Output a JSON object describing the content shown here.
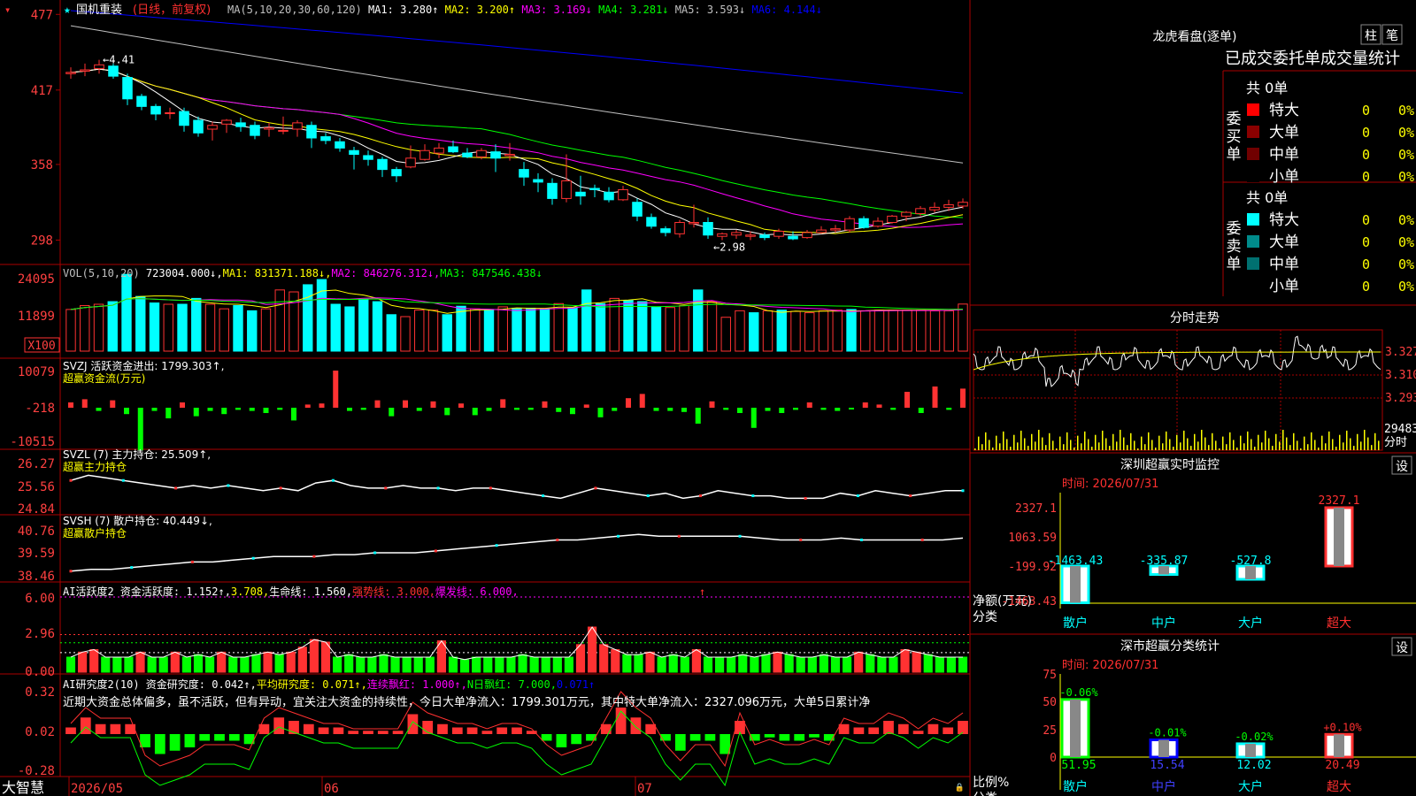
{
  "colors": {
    "up": "#ff3232",
    "down": "#00ffff",
    "frame": "#aa0000",
    "axis_text": "#ff4040",
    "ma1": "#ffffff",
    "ma2": "#ffff00",
    "ma3": "#ff00ff",
    "ma4": "#00ff00",
    "ma5": "#c0c0c0",
    "ma6": "#0000ff"
  },
  "price": {
    "header": {
      "name": "国机重装",
      "period": "(日线，前复权)",
      "ma_params": "MA(5,10,20,30,60,120)",
      "items": [
        {
          "label": "MA1:",
          "value": "3.280",
          "arrow": "↑",
          "color": "#ffffff"
        },
        {
          "label": "MA2:",
          "value": "3.200",
          "arrow": "↑",
          "color": "#ffff00"
        },
        {
          "label": "MA3:",
          "value": "3.169",
          "arrow": "↓",
          "color": "#ff00ff"
        },
        {
          "label": "MA4:",
          "value": "3.281",
          "arrow": "↓",
          "color": "#00ff00"
        },
        {
          "label": "MA5:",
          "value": "3.593",
          "arrow": "↓",
          "color": "#c0c0c0"
        },
        {
          "label": "MA6:",
          "value": "4.144",
          "arrow": "↓",
          "color": "#0000ff"
        }
      ]
    },
    "yticks": [
      "477",
      "417",
      "358",
      "298"
    ],
    "high_label": "←4.41",
    "low_label": "←2.98"
  },
  "volume": {
    "header": [
      {
        "text": "VOL(5,10,20)",
        "color": "#c0c0c0"
      },
      {
        "text": " 723004.000↓,",
        "color": "#ffffff"
      },
      {
        "text": "MA1: 831371.188↓,",
        "color": "#ffff00"
      },
      {
        "text": "MA2: 846276.312↓,",
        "color": "#ff00ff"
      },
      {
        "text": "MA3: 847546.438↓",
        "color": "#00ff00"
      }
    ],
    "yticks": [
      "24095",
      "11899"
    ],
    "unit": "X100"
  },
  "svzj": {
    "header": "SVZJ  活跃资金进出: 1799.303↑,",
    "sub": "超赢资金流(万元)",
    "yticks": [
      "10079",
      "-218",
      "-10515"
    ]
  },
  "svzl": {
    "header": "SVZL (7) 主力持仓: 25.509↑,",
    "sub": "超赢主力持仓",
    "yticks": [
      "26.27",
      "25.56",
      "24.84"
    ]
  },
  "svsh": {
    "header": "SVSH (7) 散户持仓: 40.449↓,",
    "sub": "超赢散户持仓",
    "yticks": [
      "40.76",
      "39.59",
      "38.46"
    ]
  },
  "ai1": {
    "header": [
      {
        "text": "AI活跃度2 资金活跃度: 1.152↑,",
        "color": "#ffffff"
      },
      {
        "text": "3.708,",
        "color": "#ffff00"
      },
      {
        "text": "生命线: 1.560,",
        "color": "#ffffff"
      },
      {
        "text": "强势线: 3.000,",
        "color": "#ff3030"
      },
      {
        "text": "爆发线: 6.000,",
        "color": "#ff00ff"
      }
    ],
    "yticks": [
      "6.00",
      "2.96",
      "0.00"
    ]
  },
  "ai2": {
    "header": [
      {
        "text": "AI研究度2(10) 资金研究度: 0.042↑,",
        "color": "#ffffff"
      },
      {
        "text": "平均研究度: 0.071↑,",
        "color": "#ffff00"
      },
      {
        "text": "连续飘红: 1.000↑,",
        "color": "#ff00ff"
      },
      {
        "text": "N日飘红: 7.000,",
        "color": "#00ff00"
      },
      {
        "text": "0.071↑",
        "color": "#0000ff"
      }
    ],
    "comment": "近期大资金总体偏多，虽不活跃，但有异动，宜关注大资金的持续性，今日大单净流入：1799.301万元，其中特大单净流入：2327.096万元，大单5日累计净",
    "yticks": [
      "0.32",
      "0.02",
      "-0.28"
    ]
  },
  "xaxis": {
    "logo": "大智慧",
    "labels": [
      "2026/05",
      "06",
      "07"
    ]
  },
  "chart_data": [
    {
      "type": "candlestick",
      "title": "国机重装 (日线，前复权)",
      "ylim": [
        2.85,
        4.8
      ],
      "ohlc": [
        [
          4.3,
          4.35,
          4.26,
          4.31
        ],
        [
          4.32,
          4.38,
          4.28,
          4.33
        ],
        [
          4.34,
          4.41,
          4.3,
          4.37
        ],
        [
          4.36,
          4.38,
          4.26,
          4.28
        ],
        [
          4.27,
          4.3,
          4.05,
          4.1
        ],
        [
          4.12,
          4.14,
          4.01,
          4.04
        ],
        [
          4.04,
          4.06,
          3.93,
          3.98
        ],
        [
          3.99,
          4.03,
          3.94,
          3.99
        ],
        [
          4.0,
          4.03,
          3.84,
          3.89
        ],
        [
          3.93,
          3.96,
          3.8,
          3.83
        ],
        [
          3.86,
          3.92,
          3.77,
          3.89
        ],
        [
          3.9,
          3.94,
          3.83,
          3.93
        ],
        [
          3.91,
          3.95,
          3.84,
          3.88
        ],
        [
          3.89,
          3.92,
          3.78,
          3.81
        ],
        [
          3.86,
          3.91,
          3.8,
          3.87
        ],
        [
          3.85,
          3.96,
          3.82,
          3.85
        ],
        [
          3.86,
          3.93,
          3.8,
          3.91
        ],
        [
          3.89,
          3.92,
          3.71,
          3.79
        ],
        [
          3.8,
          3.83,
          3.74,
          3.77
        ],
        [
          3.76,
          3.79,
          3.68,
          3.71
        ],
        [
          3.69,
          3.72,
          3.54,
          3.66
        ],
        [
          3.65,
          3.69,
          3.57,
          3.62
        ],
        [
          3.62,
          3.64,
          3.48,
          3.54
        ],
        [
          3.54,
          3.56,
          3.44,
          3.49
        ],
        [
          3.56,
          3.73,
          3.55,
          3.63
        ],
        [
          3.62,
          3.74,
          3.61,
          3.69
        ],
        [
          3.67,
          3.75,
          3.63,
          3.71
        ],
        [
          3.72,
          3.77,
          3.67,
          3.68
        ],
        [
          3.67,
          3.71,
          3.63,
          3.64
        ],
        [
          3.64,
          3.71,
          3.62,
          3.69
        ],
        [
          3.68,
          3.74,
          3.52,
          3.63
        ],
        [
          3.65,
          3.75,
          3.61,
          3.66
        ],
        [
          3.54,
          3.6,
          3.41,
          3.48
        ],
        [
          3.46,
          3.51,
          3.36,
          3.44
        ],
        [
          3.43,
          3.47,
          3.26,
          3.31
        ],
        [
          3.31,
          3.66,
          3.28,
          3.45
        ],
        [
          3.36,
          3.49,
          3.26,
          3.33
        ],
        [
          3.39,
          3.42,
          3.32,
          3.38
        ],
        [
          3.36,
          3.4,
          3.28,
          3.3
        ],
        [
          3.3,
          3.41,
          3.29,
          3.38
        ],
        [
          3.28,
          3.31,
          3.13,
          3.17
        ],
        [
          3.16,
          3.19,
          3.07,
          3.09
        ],
        [
          3.07,
          3.09,
          3.01,
          3.04
        ],
        [
          3.03,
          3.14,
          3.0,
          3.12
        ],
        [
          3.11,
          3.26,
          3.08,
          3.12
        ],
        [
          3.12,
          3.16,
          2.99,
          3.02
        ],
        [
          3.01,
          3.04,
          2.98,
          3.03
        ],
        [
          3.02,
          3.06,
          2.99,
          3.04
        ],
        [
          3.01,
          3.05,
          2.98,
          3.02
        ],
        [
          3.02,
          3.04,
          2.98,
          3.0
        ],
        [
          3.01,
          3.07,
          2.99,
          3.05
        ],
        [
          3.01,
          3.05,
          2.98,
          2.99
        ],
        [
          3.0,
          3.06,
          2.99,
          3.04
        ],
        [
          3.04,
          3.09,
          3.03,
          3.06
        ],
        [
          3.06,
          3.1,
          3.04,
          3.07
        ],
        [
          3.06,
          3.17,
          3.04,
          3.15
        ],
        [
          3.15,
          3.17,
          3.07,
          3.08
        ],
        [
          3.09,
          3.16,
          3.08,
          3.13
        ],
        [
          3.12,
          3.18,
          3.11,
          3.17
        ],
        [
          3.17,
          3.21,
          3.13,
          3.2
        ],
        [
          3.19,
          3.25,
          3.17,
          3.23
        ],
        [
          3.22,
          3.28,
          3.2,
          3.24
        ],
        [
          3.24,
          3.3,
          3.21,
          3.26
        ],
        [
          3.25,
          3.31,
          3.23,
          3.28
        ]
      ]
    },
    {
      "type": "bar",
      "title": "VOL(5,10,20)",
      "values": [
        6400,
        7000,
        7200,
        7600,
        11800,
        8400,
        7400,
        7200,
        7200,
        8100,
        7200,
        6500,
        7000,
        6200,
        6500,
        9400,
        9100,
        10200,
        11000,
        7200,
        6800,
        7900,
        7600,
        5600,
        5300,
        6300,
        6300,
        5600,
        6900,
        6500,
        6400,
        6800,
        6600,
        6600,
        6500,
        7300,
        6700,
        9400,
        7300,
        8100,
        7800,
        7600,
        6800,
        6700,
        7000,
        9400,
        7600,
        5200,
        6200,
        5900,
        6200,
        6300,
        6100,
        5900,
        6200,
        6300,
        6400,
        6200,
        6300,
        6300,
        6300,
        6300,
        6200,
        6200,
        7230
      ]
    },
    {
      "type": "bar",
      "title": "超赢资金流(万元)",
      "values": [
        500,
        800,
        -300,
        700,
        -600,
        -4000,
        -300,
        -1000,
        500,
        -800,
        -300,
        -600,
        -200,
        -300,
        -500,
        -200,
        -1200,
        300,
        400,
        3500,
        -300,
        -200,
        700,
        -800,
        700,
        -300,
        600,
        -700,
        400,
        -700,
        -300,
        800,
        -200,
        -200,
        600,
        -400,
        -600,
        300,
        -900,
        -300,
        900,
        1300,
        -300,
        -300,
        -400,
        -1500,
        600,
        -200,
        -500,
        -1900,
        -300,
        -500,
        -200,
        500,
        -200,
        -300,
        -100,
        500,
        300,
        -200,
        1500,
        -500,
        2000,
        -200,
        1800
      ]
    },
    {
      "type": "line",
      "title": "超赢主力持仓",
      "values": [
        25.9,
        26.1,
        26.0,
        25.9,
        25.8,
        25.7,
        25.6,
        25.7,
        25.6,
        25.7,
        25.6,
        25.5,
        25.6,
        25.5,
        25.8,
        25.9,
        25.7,
        25.6,
        25.6,
        25.7,
        25.6,
        25.6,
        25.5,
        25.6,
        25.6,
        25.5,
        25.4,
        25.3,
        25.2,
        25.4,
        25.6,
        25.5,
        25.4,
        25.3,
        25.4,
        25.2,
        25.3,
        25.5,
        25.4,
        25.3,
        25.3,
        25.2,
        25.2,
        25.2,
        25.4,
        25.3,
        25.5,
        25.4,
        25.3,
        25.4,
        25.5,
        25.5
      ]
    },
    {
      "type": "line",
      "title": "超赢散户持仓",
      "values": [
        38.7,
        38.8,
        38.8,
        38.9,
        39.0,
        39.1,
        39.2,
        39.2,
        39.3,
        39.4,
        39.5,
        39.5,
        39.5,
        39.6,
        39.6,
        39.7,
        39.7,
        39.7,
        39.8,
        39.9,
        40.0,
        40.1,
        40.2,
        40.3,
        40.4,
        40.4,
        40.5,
        40.6,
        40.7,
        40.6,
        40.6,
        40.6,
        40.6,
        40.6,
        40.5,
        40.4,
        40.4,
        40.4,
        40.5,
        40.4,
        40.4,
        40.4,
        40.4,
        40.4,
        40.5
      ]
    },
    {
      "type": "bar",
      "title": "AI活跃度2",
      "values": [
        1.2,
        1.6,
        1.8,
        1.2,
        1.2,
        1.2,
        1.6,
        1.2,
        1.2,
        1.6,
        1.2,
        1.4,
        1.2,
        1.6,
        1.2,
        1.2,
        1.4,
        1.6,
        1.4,
        1.6,
        2.0,
        2.6,
        2.4,
        1.2,
        1.4,
        1.2,
        1.2,
        1.4,
        1.2,
        1.2,
        1.2,
        1.2,
        2.5,
        1.2,
        1.0,
        1.2,
        1.2,
        1.2,
        1.2,
        1.4,
        1.2,
        1.2,
        1.2,
        1.2,
        2.2,
        3.6,
        2.2,
        1.8,
        1.4,
        1.4,
        1.6,
        1.2,
        1.4,
        1.2,
        1.8,
        1.2,
        1.2,
        1.2,
        1.4,
        1.2,
        1.4,
        1.6,
        1.4,
        1.2,
        1.2,
        1.4,
        1.2,
        1.2,
        1.6,
        1.4,
        1.2,
        1.2,
        1.8,
        1.6,
        1.4,
        1.2,
        1.2,
        1.2
      ]
    },
    {
      "type": "bar",
      "title": "AI研究度2(10)",
      "values": [
        0.02,
        0.05,
        0.03,
        0.03,
        0.03,
        -0.04,
        -0.06,
        -0.05,
        -0.04,
        -0.02,
        -0.02,
        -0.02,
        -0.03,
        0.03,
        0.05,
        0.04,
        0.03,
        0.02,
        0.02,
        0.01,
        0.01,
        0.01,
        0.01,
        0.06,
        0.04,
        0.03,
        0.02,
        0.02,
        0.01,
        0.02,
        0.02,
        0.01,
        -0.02,
        -0.04,
        -0.03,
        -0.02,
        0.03,
        0.08,
        0.05,
        0.03,
        -0.02,
        -0.05,
        -0.02,
        -0.02,
        -0.06,
        0.04,
        -0.02,
        -0.01,
        -0.02,
        -0.02,
        -0.01,
        -0.02,
        0.03,
        0.02,
        0.02,
        0.04,
        0.03,
        0.01,
        0.03,
        0.02,
        0.04
      ]
    },
    {
      "type": "table",
      "title": "龙虎看盘(逐单)",
      "buttons": [
        "柱",
        "笔"
      ],
      "heading": "已成交委托单成交量统计",
      "buy": {
        "label": "委买单",
        "total": "共 0单",
        "rows": [
          {
            "name": "特大",
            "count": "0",
            "pct": "0%",
            "color": "#ff0000"
          },
          {
            "name": "大单",
            "count": "0",
            "pct": "0%",
            "color": "#8b0000"
          },
          {
            "name": "中单",
            "count": "0",
            "pct": "0%",
            "color": "#700000"
          },
          {
            "name": "小单",
            "count": "0",
            "pct": "0%",
            "color": "#000000"
          }
        ]
      },
      "sell": {
        "label": "委卖单",
        "total": "共 0单",
        "rows": [
          {
            "name": "特大",
            "count": "0",
            "pct": "0%",
            "color": "#00ffff"
          },
          {
            "name": "大单",
            "count": "0",
            "pct": "0%",
            "color": "#008b8b"
          },
          {
            "name": "中单",
            "count": "0",
            "pct": "0%",
            "color": "#007070"
          },
          {
            "name": "小单",
            "count": "0",
            "pct": "0%",
            "color": "#000000"
          }
        ]
      }
    },
    {
      "type": "line",
      "title": "分时走势",
      "yticks": [
        "3.327",
        "3.310",
        "3.293"
      ],
      "vol_label": "29483",
      "time_label": "分时"
    },
    {
      "type": "bar",
      "title": "深圳超赢实时监控",
      "date": "时间: 2026/07/31",
      "yticks": [
        "2327.1",
        "1063.59",
        "-199.92",
        "-1463.43"
      ],
      "ylabel": "净额(万元)",
      "xlabel": "分类",
      "categories": [
        "散户",
        "中户",
        "大户",
        "超大"
      ],
      "values": [
        -1463.43,
        -335.87,
        -527.8,
        2327.1
      ],
      "value_labels": [
        "-1463.43",
        "-335.87",
        "-527.8",
        "2327.1"
      ],
      "settings": "设"
    },
    {
      "type": "bar",
      "title": "深市超赢分类统计",
      "date": "时间: 2026/07/31",
      "yticks": [
        "75",
        "50",
        "25",
        "0"
      ],
      "ylabel": "比例%",
      "xlabel": "分类",
      "categories": [
        "散户",
        "中户",
        "大户",
        "超大"
      ],
      "values": [
        51.95,
        15.54,
        12.02,
        20.49
      ],
      "value_labels": [
        "51.95",
        "15.54",
        "12.02",
        "20.49"
      ],
      "change_labels": [
        "-0.06%",
        "-0.01%",
        "-0.02%",
        "+0.10%"
      ],
      "settings": "设"
    }
  ]
}
